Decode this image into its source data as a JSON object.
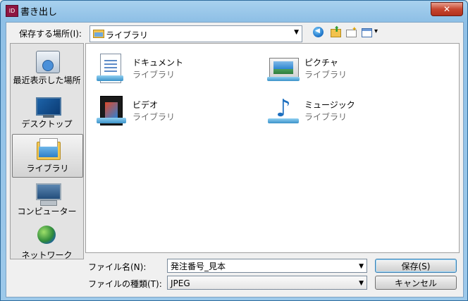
{
  "window": {
    "title": "書き出し",
    "app_icon_text": "ID",
    "close_label": "✕"
  },
  "toolbar": {
    "lookin_label": "保存する場所(I):",
    "lookin_value": "ライブラリ",
    "icons": [
      "back-icon",
      "up-folder-icon",
      "new-folder-icon",
      "views-menu-icon"
    ]
  },
  "places": [
    {
      "label": "最近表示した場所",
      "icon": "recent-places-icon"
    },
    {
      "label": "デスクトップ",
      "icon": "desktop-icon"
    },
    {
      "label": "ライブラリ",
      "icon": "libraries-icon",
      "selected": true
    },
    {
      "label": "コンピューター",
      "icon": "computer-icon"
    },
    {
      "label": "ネットワーク",
      "icon": "network-icon"
    }
  ],
  "items": [
    {
      "name": "ドキュメント",
      "sub": "ライブラリ",
      "icon": "documents-library-icon"
    },
    {
      "name": "ピクチャ",
      "sub": "ライブラリ",
      "icon": "pictures-library-icon"
    },
    {
      "name": "ビデオ",
      "sub": "ライブラリ",
      "icon": "videos-library-icon"
    },
    {
      "name": "ミュージック",
      "sub": "ライブラリ",
      "icon": "music-library-icon"
    }
  ],
  "form": {
    "filename_label": "ファイル名(N):",
    "filename_value": "発注番号_見本",
    "filetype_label": "ファイルの種類(T):",
    "filetype_value": "JPEG"
  },
  "buttons": {
    "save": "保存(S)",
    "cancel": "キャンセル"
  },
  "colors": {
    "titlebar": "#9dc9ea",
    "close": "#c7462f",
    "selection": "#d3d3d3"
  }
}
